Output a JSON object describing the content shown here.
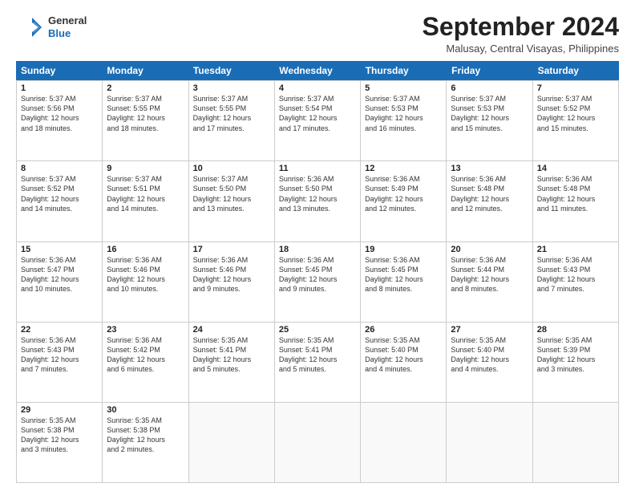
{
  "logo": {
    "line1": "General",
    "line2": "Blue"
  },
  "title": "September 2024",
  "location": "Malusay, Central Visayas, Philippines",
  "header": {
    "days": [
      "Sunday",
      "Monday",
      "Tuesday",
      "Wednesday",
      "Thursday",
      "Friday",
      "Saturday"
    ]
  },
  "weeks": [
    {
      "cells": [
        {
          "day": "1",
          "lines": [
            "Sunrise: 5:37 AM",
            "Sunset: 5:56 PM",
            "Daylight: 12 hours",
            "and 18 minutes."
          ]
        },
        {
          "day": "2",
          "lines": [
            "Sunrise: 5:37 AM",
            "Sunset: 5:55 PM",
            "Daylight: 12 hours",
            "and 18 minutes."
          ]
        },
        {
          "day": "3",
          "lines": [
            "Sunrise: 5:37 AM",
            "Sunset: 5:55 PM",
            "Daylight: 12 hours",
            "and 17 minutes."
          ]
        },
        {
          "day": "4",
          "lines": [
            "Sunrise: 5:37 AM",
            "Sunset: 5:54 PM",
            "Daylight: 12 hours",
            "and 17 minutes."
          ]
        },
        {
          "day": "5",
          "lines": [
            "Sunrise: 5:37 AM",
            "Sunset: 5:53 PM",
            "Daylight: 12 hours",
            "and 16 minutes."
          ]
        },
        {
          "day": "6",
          "lines": [
            "Sunrise: 5:37 AM",
            "Sunset: 5:53 PM",
            "Daylight: 12 hours",
            "and 15 minutes."
          ]
        },
        {
          "day": "7",
          "lines": [
            "Sunrise: 5:37 AM",
            "Sunset: 5:52 PM",
            "Daylight: 12 hours",
            "and 15 minutes."
          ]
        }
      ]
    },
    {
      "cells": [
        {
          "day": "8",
          "lines": [
            "Sunrise: 5:37 AM",
            "Sunset: 5:52 PM",
            "Daylight: 12 hours",
            "and 14 minutes."
          ]
        },
        {
          "day": "9",
          "lines": [
            "Sunrise: 5:37 AM",
            "Sunset: 5:51 PM",
            "Daylight: 12 hours",
            "and 14 minutes."
          ]
        },
        {
          "day": "10",
          "lines": [
            "Sunrise: 5:37 AM",
            "Sunset: 5:50 PM",
            "Daylight: 12 hours",
            "and 13 minutes."
          ]
        },
        {
          "day": "11",
          "lines": [
            "Sunrise: 5:36 AM",
            "Sunset: 5:50 PM",
            "Daylight: 12 hours",
            "and 13 minutes."
          ]
        },
        {
          "day": "12",
          "lines": [
            "Sunrise: 5:36 AM",
            "Sunset: 5:49 PM",
            "Daylight: 12 hours",
            "and 12 minutes."
          ]
        },
        {
          "day": "13",
          "lines": [
            "Sunrise: 5:36 AM",
            "Sunset: 5:48 PM",
            "Daylight: 12 hours",
            "and 12 minutes."
          ]
        },
        {
          "day": "14",
          "lines": [
            "Sunrise: 5:36 AM",
            "Sunset: 5:48 PM",
            "Daylight: 12 hours",
            "and 11 minutes."
          ]
        }
      ]
    },
    {
      "cells": [
        {
          "day": "15",
          "lines": [
            "Sunrise: 5:36 AM",
            "Sunset: 5:47 PM",
            "Daylight: 12 hours",
            "and 10 minutes."
          ]
        },
        {
          "day": "16",
          "lines": [
            "Sunrise: 5:36 AM",
            "Sunset: 5:46 PM",
            "Daylight: 12 hours",
            "and 10 minutes."
          ]
        },
        {
          "day": "17",
          "lines": [
            "Sunrise: 5:36 AM",
            "Sunset: 5:46 PM",
            "Daylight: 12 hours",
            "and 9 minutes."
          ]
        },
        {
          "day": "18",
          "lines": [
            "Sunrise: 5:36 AM",
            "Sunset: 5:45 PM",
            "Daylight: 12 hours",
            "and 9 minutes."
          ]
        },
        {
          "day": "19",
          "lines": [
            "Sunrise: 5:36 AM",
            "Sunset: 5:45 PM",
            "Daylight: 12 hours",
            "and 8 minutes."
          ]
        },
        {
          "day": "20",
          "lines": [
            "Sunrise: 5:36 AM",
            "Sunset: 5:44 PM",
            "Daylight: 12 hours",
            "and 8 minutes."
          ]
        },
        {
          "day": "21",
          "lines": [
            "Sunrise: 5:36 AM",
            "Sunset: 5:43 PM",
            "Daylight: 12 hours",
            "and 7 minutes."
          ]
        }
      ]
    },
    {
      "cells": [
        {
          "day": "22",
          "lines": [
            "Sunrise: 5:36 AM",
            "Sunset: 5:43 PM",
            "Daylight: 12 hours",
            "and 7 minutes."
          ]
        },
        {
          "day": "23",
          "lines": [
            "Sunrise: 5:36 AM",
            "Sunset: 5:42 PM",
            "Daylight: 12 hours",
            "and 6 minutes."
          ]
        },
        {
          "day": "24",
          "lines": [
            "Sunrise: 5:35 AM",
            "Sunset: 5:41 PM",
            "Daylight: 12 hours",
            "and 5 minutes."
          ]
        },
        {
          "day": "25",
          "lines": [
            "Sunrise: 5:35 AM",
            "Sunset: 5:41 PM",
            "Daylight: 12 hours",
            "and 5 minutes."
          ]
        },
        {
          "day": "26",
          "lines": [
            "Sunrise: 5:35 AM",
            "Sunset: 5:40 PM",
            "Daylight: 12 hours",
            "and 4 minutes."
          ]
        },
        {
          "day": "27",
          "lines": [
            "Sunrise: 5:35 AM",
            "Sunset: 5:40 PM",
            "Daylight: 12 hours",
            "and 4 minutes."
          ]
        },
        {
          "day": "28",
          "lines": [
            "Sunrise: 5:35 AM",
            "Sunset: 5:39 PM",
            "Daylight: 12 hours",
            "and 3 minutes."
          ]
        }
      ]
    },
    {
      "cells": [
        {
          "day": "29",
          "lines": [
            "Sunrise: 5:35 AM",
            "Sunset: 5:38 PM",
            "Daylight: 12 hours",
            "and 3 minutes."
          ]
        },
        {
          "day": "30",
          "lines": [
            "Sunrise: 5:35 AM",
            "Sunset: 5:38 PM",
            "Daylight: 12 hours",
            "and 2 minutes."
          ]
        },
        {
          "day": "",
          "lines": []
        },
        {
          "day": "",
          "lines": []
        },
        {
          "day": "",
          "lines": []
        },
        {
          "day": "",
          "lines": []
        },
        {
          "day": "",
          "lines": []
        }
      ]
    }
  ]
}
